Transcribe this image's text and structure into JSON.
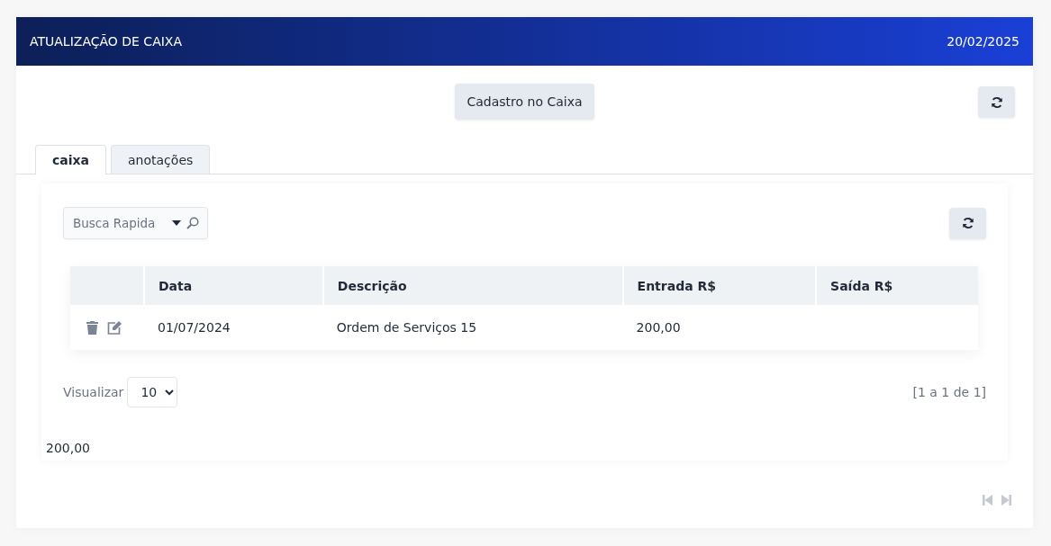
{
  "header": {
    "title": "ATUALIZAÇÃO DE CAIXA",
    "date": "20/02/2025"
  },
  "toolbar": {
    "register_button": "Cadastro no Caixa"
  },
  "tabs": [
    {
      "label": "caixa",
      "selected": true
    },
    {
      "label": "anotações",
      "selected": false
    }
  ],
  "search": {
    "placeholder": "Busca Rapida"
  },
  "table": {
    "columns": [
      "Data",
      "Descrição",
      "Entrada R$",
      "Saída R$"
    ],
    "rows": [
      {
        "cells": [
          "01/07/2024",
          "Ordem de Serviços 15",
          "200,00",
          ""
        ]
      }
    ]
  },
  "pagination": {
    "label": "Visualizar",
    "page_size": "10",
    "range": "[1 a 1 de 1]"
  },
  "total": "200,00"
}
